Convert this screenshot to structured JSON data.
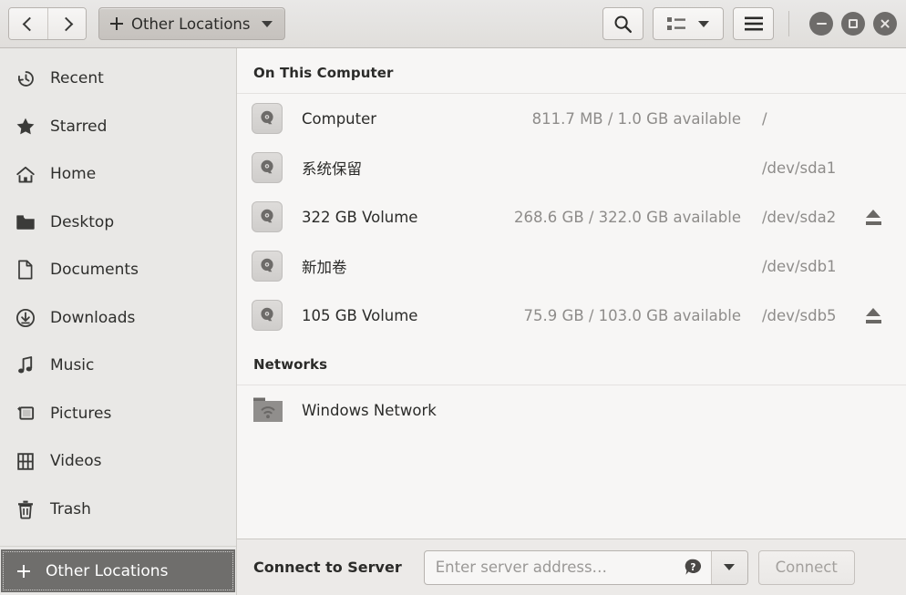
{
  "window": {
    "title": "Other Locations",
    "controls": {
      "minimize": "minimize",
      "maximize": "maximize",
      "close": "close"
    }
  },
  "header": {
    "back_label": "Back",
    "forward_label": "Forward",
    "path_button_label": "Other Locations",
    "search_label": "Search",
    "view_label": "View options",
    "menu_label": "Main menu"
  },
  "sidebar": {
    "items": [
      {
        "label": "Recent",
        "icon": "history-icon"
      },
      {
        "label": "Starred",
        "icon": "star-icon"
      },
      {
        "label": "Home",
        "icon": "home-icon"
      },
      {
        "label": "Desktop",
        "icon": "folder-icon"
      },
      {
        "label": "Documents",
        "icon": "document-icon"
      },
      {
        "label": "Downloads",
        "icon": "download-icon"
      },
      {
        "label": "Music",
        "icon": "music-note-icon"
      },
      {
        "label": "Pictures",
        "icon": "picture-icon"
      },
      {
        "label": "Videos",
        "icon": "film-icon"
      },
      {
        "label": "Trash",
        "icon": "trash-icon"
      }
    ],
    "other_locations": {
      "label": "Other Locations",
      "selected": true
    }
  },
  "main": {
    "sections": [
      {
        "title": "On This Computer",
        "rows": [
          {
            "name": "Computer",
            "space": "811.7 MB / 1.0 GB available",
            "device": "/",
            "eject": false,
            "icon": "drive-harddisk-icon"
          },
          {
            "name": "系统保留",
            "space": "",
            "device": "/dev/sda1",
            "eject": false,
            "icon": "drive-harddisk-icon"
          },
          {
            "name": "322 GB Volume",
            "space": "268.6 GB / 322.0 GB available",
            "device": "/dev/sda2",
            "eject": true,
            "icon": "drive-harddisk-icon"
          },
          {
            "name": "新加卷",
            "space": "",
            "device": "/dev/sdb1",
            "eject": false,
            "icon": "drive-harddisk-icon"
          },
          {
            "name": "105 GB Volume",
            "space": "75.9 GB / 103.0 GB available",
            "device": "/dev/sdb5",
            "eject": true,
            "icon": "drive-harddisk-icon"
          }
        ]
      },
      {
        "title": "Networks",
        "rows": [
          {
            "name": "Windows Network",
            "space": "",
            "device": "",
            "eject": false,
            "icon": "network-folder-icon"
          }
        ]
      }
    ]
  },
  "bottom": {
    "connect_label": "Connect to Server",
    "address_value": "",
    "address_placeholder": "Enter server address…",
    "help_label": "Help",
    "dropdown_label": "Recent servers",
    "connect_button": "Connect",
    "connect_button_disabled": true
  },
  "colors": {
    "headerbar": "#e4e2df",
    "sidebar": "#e9e8e6",
    "content": "#f7f6f5",
    "selection": "#6f6e6c",
    "text": "#2b2b29",
    "dim_text": "#8e8c8a"
  }
}
